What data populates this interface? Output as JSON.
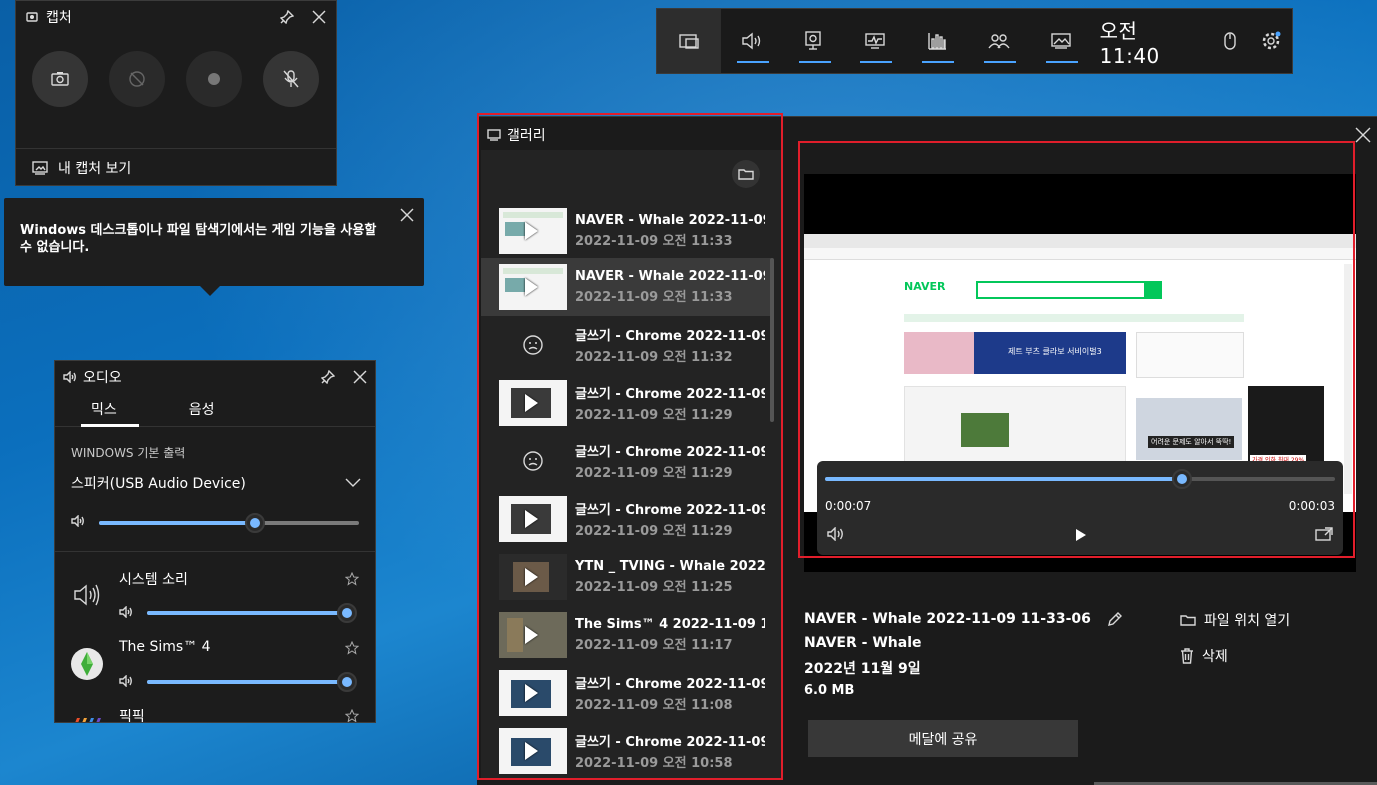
{
  "capture": {
    "title": "캡처",
    "footer": "내 캡처 보기"
  },
  "tooltip": {
    "text": "Windows 데스크톱이나 파일 탐색기에서는 게임 기능을 사용할 수 없습니다."
  },
  "gamebar": {
    "clock": "오전 11:40",
    "accent": "#4aa3ff",
    "icons": [
      "widget-menu-icon",
      "audio-icon",
      "capture-icon",
      "performance-icon",
      "resources-icon",
      "xbox-social-icon",
      "gallery-icon",
      "mouse-icon",
      "settings-icon"
    ]
  },
  "audio": {
    "title": "오디오",
    "tabs": [
      "믹스",
      "음성"
    ],
    "output_heading": "WINDOWS 기본 출력",
    "device": "스피커(USB Audio Device)",
    "master_level": 0.6,
    "apps": [
      {
        "name": "시스템 소리",
        "level": 1.0
      },
      {
        "name": "The Sims™ 4",
        "level": 1.0
      },
      {
        "name": "픽픽"
      }
    ]
  },
  "gallery": {
    "title": "갤러리",
    "items": [
      {
        "title": "NAVER - Whale 2022-11-09 1...",
        "date": "2022-11-09 오전 11:33"
      },
      {
        "title": "NAVER - Whale 2022-11-09 1...",
        "date": "2022-11-09 오전 11:33"
      },
      {
        "title": "글쓰기 - Chrome 2022-11-09...",
        "date": "2022-11-09 오전 11:32"
      },
      {
        "title": "글쓰기 - Chrome 2022-11-09...",
        "date": "2022-11-09 오전 11:29"
      },
      {
        "title": "글쓰기 - Chrome 2022-11-09...",
        "date": "2022-11-09 오전 11:29"
      },
      {
        "title": "글쓰기 - Chrome 2022-11-09...",
        "date": "2022-11-09 오전 11:29"
      },
      {
        "title": "YTN _ TVING - Whale 2022-1...",
        "date": "2022-11-09 오전 11:25"
      },
      {
        "title": "The Sims™ 4 2022-11-09 11-1...",
        "date": "2022-11-09 오전 11:17"
      },
      {
        "title": "글쓰기 - Chrome 2022-11-09...",
        "date": "2022-11-09 오전 11:08"
      },
      {
        "title": "글쓰기 - Chrome 2022-11-09...",
        "date": "2022-11-09 오전 10:58"
      }
    ],
    "player": {
      "elapsed": "0:00:07",
      "remaining": "0:00:03",
      "progress": 0.7
    },
    "details": {
      "filename": "NAVER - Whale 2022-11-09 11-33-06",
      "app": "NAVER - Whale",
      "date": "2022년 11월 9일",
      "size": "6.0 MB"
    },
    "actions": {
      "open_location": "파일 위치 열기",
      "delete": "삭제",
      "share": "메달에 공유"
    }
  },
  "preview": {
    "site": "NAVER",
    "banner": "제트 부츠 클라보 서비이벌3",
    "ad_caption": "어려운 문제도 알아서 뚝딱!",
    "price_tag": "가격 인하 최대 29%"
  }
}
